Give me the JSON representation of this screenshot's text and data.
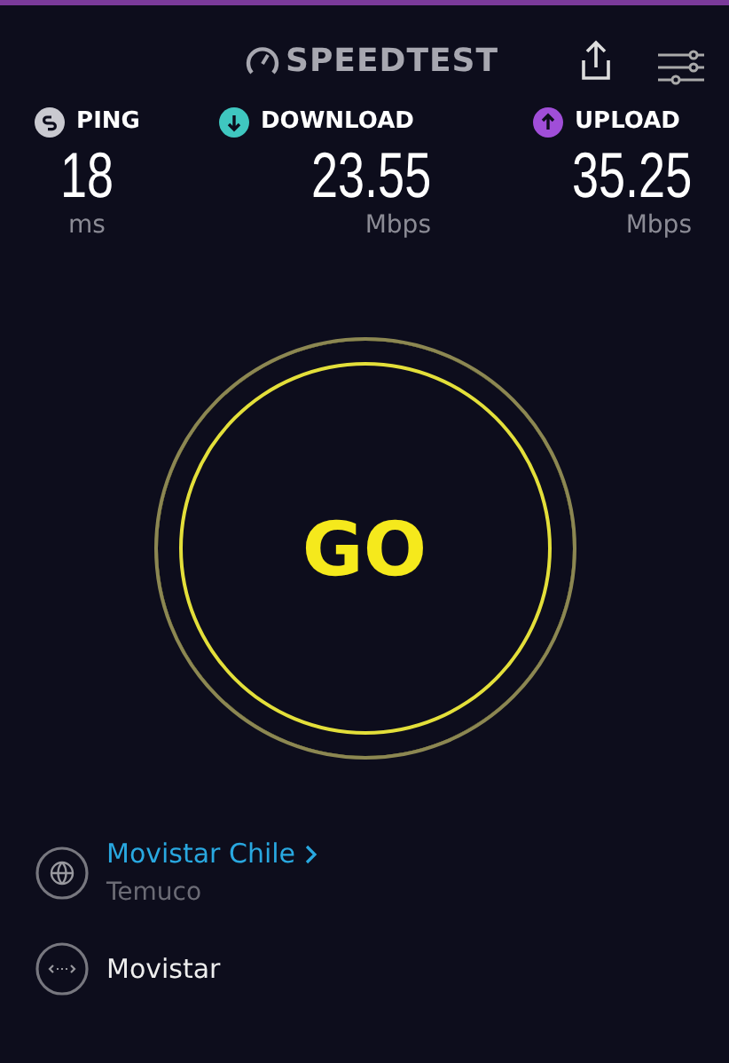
{
  "header": {
    "logo": "SPEEDTEST"
  },
  "metrics": [
    {
      "kind": "ping",
      "label": "PING",
      "value": "18",
      "unit": "ms",
      "color": "#c9c9d0"
    },
    {
      "kind": "download",
      "label": "DOWNLOAD",
      "value": "23.55",
      "unit": "Mbps",
      "color": "#3fc7c0"
    },
    {
      "kind": "upload",
      "label": "UPLOAD",
      "value": "35.25",
      "unit": "Mbps",
      "color": "#a04ed8"
    }
  ],
  "go_button": {
    "label": "GO"
  },
  "provider": {
    "name": "Movistar Chile",
    "location": "Temuco"
  },
  "server": {
    "name": "Movistar"
  }
}
